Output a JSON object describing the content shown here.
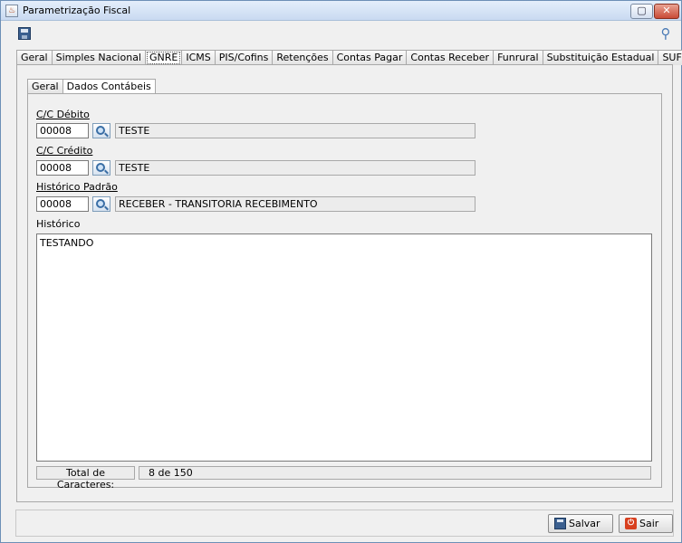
{
  "window": {
    "title": "Parametrização Fiscal",
    "app_icon_glyph": "♨",
    "restore_glyph": "▢",
    "close_glyph": "✕"
  },
  "toolbar": {
    "key_glyph": "⚲"
  },
  "tabs": [
    {
      "label": "Geral",
      "active": false
    },
    {
      "label": "Simples Nacional",
      "active": false
    },
    {
      "label": "GNRE",
      "active": true
    },
    {
      "label": "ICMS",
      "active": false
    },
    {
      "label": "PIS/Cofins",
      "active": false
    },
    {
      "label": "Retenções",
      "active": false
    },
    {
      "label": "Contas Pagar",
      "active": false
    },
    {
      "label": "Contas Receber",
      "active": false
    },
    {
      "label": "Funrural",
      "active": false
    },
    {
      "label": "Substituição Estadual",
      "active": false
    },
    {
      "label": "SUFRAMA",
      "active": false
    }
  ],
  "subtabs": [
    {
      "label": "Geral",
      "active": false
    },
    {
      "label": "Dados Contábeis",
      "active": true
    }
  ],
  "form": {
    "cc_debito": {
      "label": "C/C Débito",
      "code": "00008",
      "description": "TESTE"
    },
    "cc_credito": {
      "label": "C/C Crédito",
      "code": "00008",
      "description": "TESTE"
    },
    "historico_padrao": {
      "label": "Histórico Padrão",
      "code": "00008",
      "description": "RECEBER - TRANSITORIA RECEBIMENTO"
    },
    "historico": {
      "label": "Histórico",
      "text": "TESTANDO"
    },
    "char_count": {
      "label": "Total de Caracteres:",
      "value": "8 de 150"
    }
  },
  "buttons": {
    "save": "Salvar",
    "exit": "Sair",
    "exit_glyph": "⏻"
  },
  "colors": {
    "title_bar": "#c9daf1",
    "close_button": "#c94a36",
    "panel_bg": "#f0f0f0"
  }
}
